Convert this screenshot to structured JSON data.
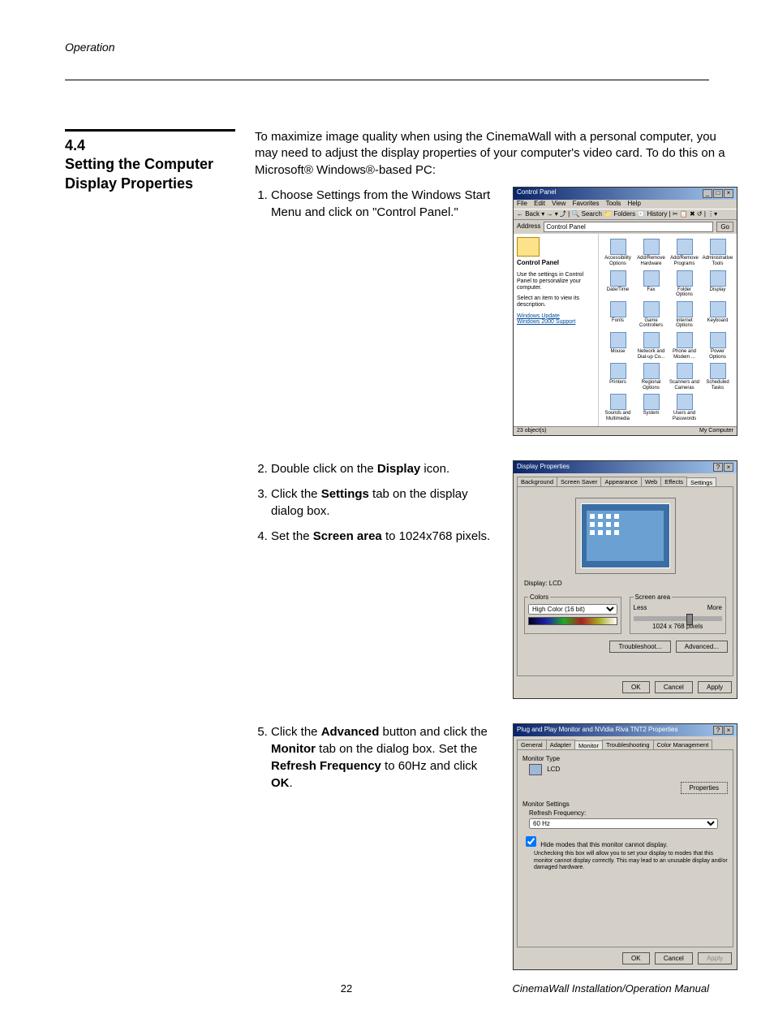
{
  "running_head": "Operation",
  "section_number": "4.4",
  "section_title_l1": "Setting the Computer",
  "section_title_l2": "Display Properties",
  "intro": "To maximize image quality when using the CinemaWall with a personal computer, you may need to adjust the display properties of your computer's video card. To do this on a Microsoft® Windows®-based PC:",
  "step1": "Choose Settings from the Windows Start Menu and click on \"Control Panel.\"",
  "step2_a": "Double click on the ",
  "step2_b": "Display",
  "step2_c": " icon.",
  "step3_a": "Click the ",
  "step3_b": "Settings",
  "step3_c": " tab on the display dialog box.",
  "step4_a": "Set the ",
  "step4_b": "Screen area",
  "step4_c": " to 1024x768 pixels.",
  "step5_a": "Click the ",
  "step5_b": "Advanced",
  "step5_c": " button and click the ",
  "step5_d": "Monitor",
  "step5_e": " tab on the dialog box. Set the ",
  "step5_f": "Refresh Frequency",
  "step5_g": " to 60Hz and click ",
  "step5_h": "OK",
  "step5_i": ".",
  "cp": {
    "title": "Control Panel",
    "menus": [
      "File",
      "Edit",
      "View",
      "Favorites",
      "Tools",
      "Help"
    ],
    "toolbar": "← Back  ▾  →  ▾  ⤴  | 🔍 Search  📁 Folders  🕘 History  |  ✂ 📋 ✖ ↺  | ⋮▾",
    "addr_label": "Address",
    "addr_value": "Control Panel",
    "go": "Go",
    "left_title": "Control Panel",
    "left_desc": "Use the settings in Control Panel to personalize your computer.",
    "left_hint": "Select an item to view its description.",
    "left_links": [
      "Windows Update",
      "Windows 2000 Support"
    ],
    "items": [
      "Accessibility Options",
      "Add/Remove Hardware",
      "Add/Remove Programs",
      "Administrative Tools",
      "Date/Time",
      "Fax",
      "Folder Options",
      "Display",
      "Fonts",
      "Game Controllers",
      "Internet Options",
      "Keyboard",
      "Mouse",
      "Network and Dial-up Co...",
      "Phone and Modem ...",
      "Power Options",
      "Printers",
      "Regional Options",
      "Scanners and Cameras",
      "Scheduled Tasks",
      "Sounds and Multimedia",
      "System",
      "Users and Passwords"
    ],
    "status_left": "23 object(s)",
    "status_right": "My Computer"
  },
  "disp": {
    "title": "Display Properties",
    "tabs": [
      "Background",
      "Screen Saver",
      "Appearance",
      "Web",
      "Effects",
      "Settings"
    ],
    "display_label": "Display:",
    "display_value": "LCD",
    "colors_legend": "Colors",
    "colors_value": "High Color (16 bit)",
    "area_legend": "Screen area",
    "area_less": "Less",
    "area_more": "More",
    "area_value": "1024 x 768 pixels",
    "troubleshoot": "Troubleshoot...",
    "advanced": "Advanced...",
    "ok": "OK",
    "cancel": "Cancel",
    "apply": "Apply"
  },
  "mon": {
    "title": "Plug and Play Monitor and NVidia Riva TNT2 Properties",
    "tabs": [
      "General",
      "Adapter",
      "Monitor",
      "Troubleshooting",
      "Color Management"
    ],
    "montype": "Monitor Type",
    "montype_val": "LCD",
    "properties": "Properties",
    "settings": "Monitor Settings",
    "refresh_label": "Refresh Frequency:",
    "refresh_value": "60 Hz",
    "hide": "Hide modes that this monitor cannot display.",
    "warn": "Unchecking this box will allow you to set your display to modes that this monitor cannot display correctly. This may lead to an unusable display and/or damaged hardware.",
    "ok": "OK",
    "cancel": "Cancel",
    "apply": "Apply"
  },
  "footer": {
    "page": "22",
    "right": "CinemaWall Installation/Operation Manual"
  }
}
